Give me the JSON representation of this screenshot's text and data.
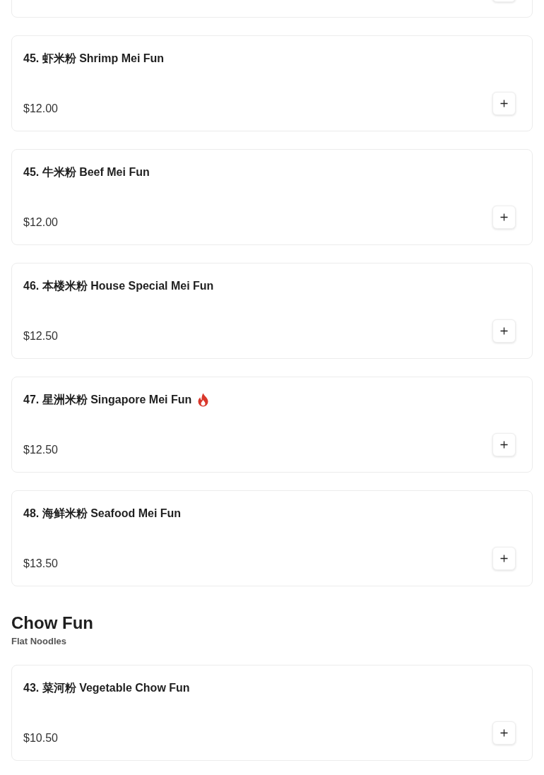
{
  "items": [
    {
      "name": "45. 虾米粉 Shrimp Mei Fun",
      "price": "$12.00",
      "spicy": false
    },
    {
      "name": "45. 牛米粉 Beef Mei Fun",
      "price": "$12.00",
      "spicy": false
    },
    {
      "name": "46. 本楼米粉 House Special Mei Fun",
      "price": "$12.50",
      "spicy": false
    },
    {
      "name": "47. 星洲米粉 Singapore Mei Fun",
      "price": "$12.50",
      "spicy": true
    },
    {
      "name": "48. 海鲜米粉 Seafood Mei Fun",
      "price": "$13.50",
      "spicy": false
    }
  ],
  "sections": [
    {
      "title": "Chow Fun",
      "subtitle": "Flat Noodles",
      "items": [
        {
          "name": "43. 菜河粉 Vegetable Chow Fun",
          "price": "$10.50",
          "spicy": false
        }
      ]
    }
  ]
}
